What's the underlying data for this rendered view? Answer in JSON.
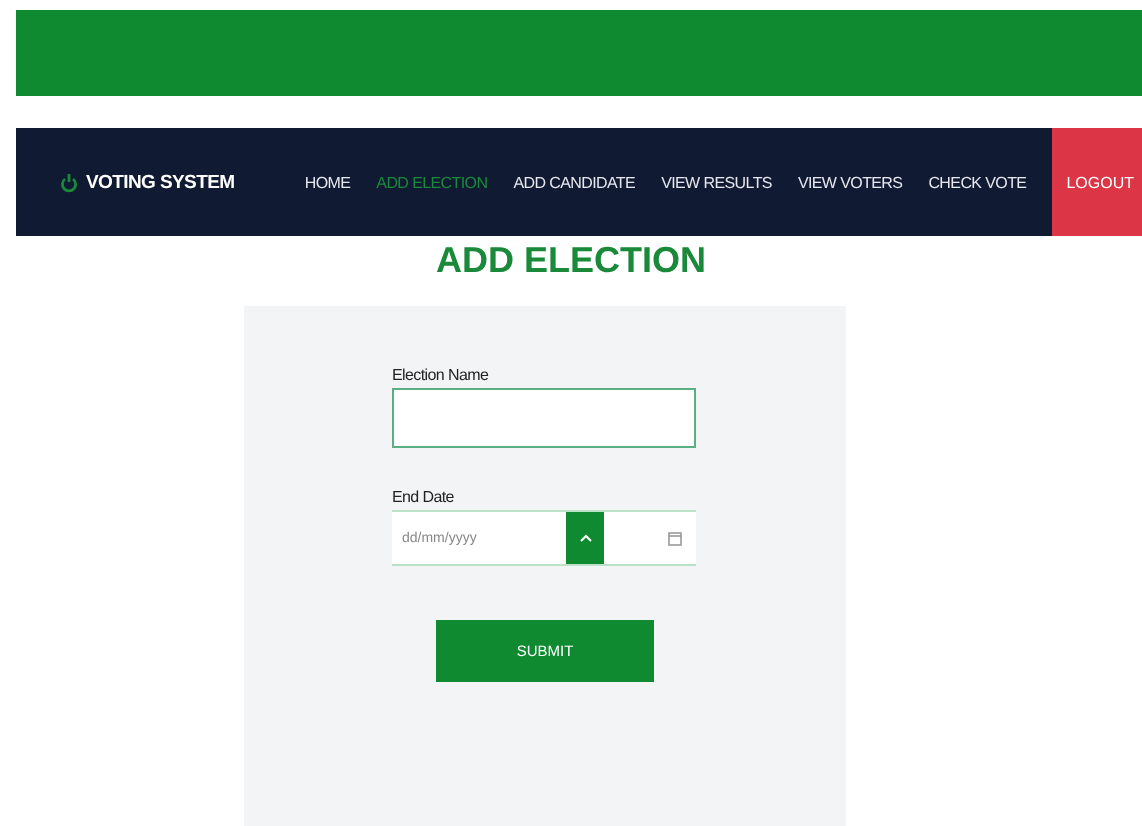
{
  "brand": "VOTING SYSTEM",
  "nav": [
    {
      "label": "HOME",
      "selected": false
    },
    {
      "label": "ADD ELECTION",
      "selected": true
    },
    {
      "label": "ADD CANDIDATE",
      "selected": false
    },
    {
      "label": "VIEW RESULTS",
      "selected": false
    },
    {
      "label": "VIEW VOTERS",
      "selected": false
    },
    {
      "label": "CHECK VOTE",
      "selected": false
    }
  ],
  "logout": "LOGOUT",
  "heading": "ADD ELECTION",
  "form": {
    "name_label": "Election Name",
    "date_label": "End Date",
    "date_placeholder": "dd/mm/yyyy",
    "submit": "SUBMIT"
  }
}
